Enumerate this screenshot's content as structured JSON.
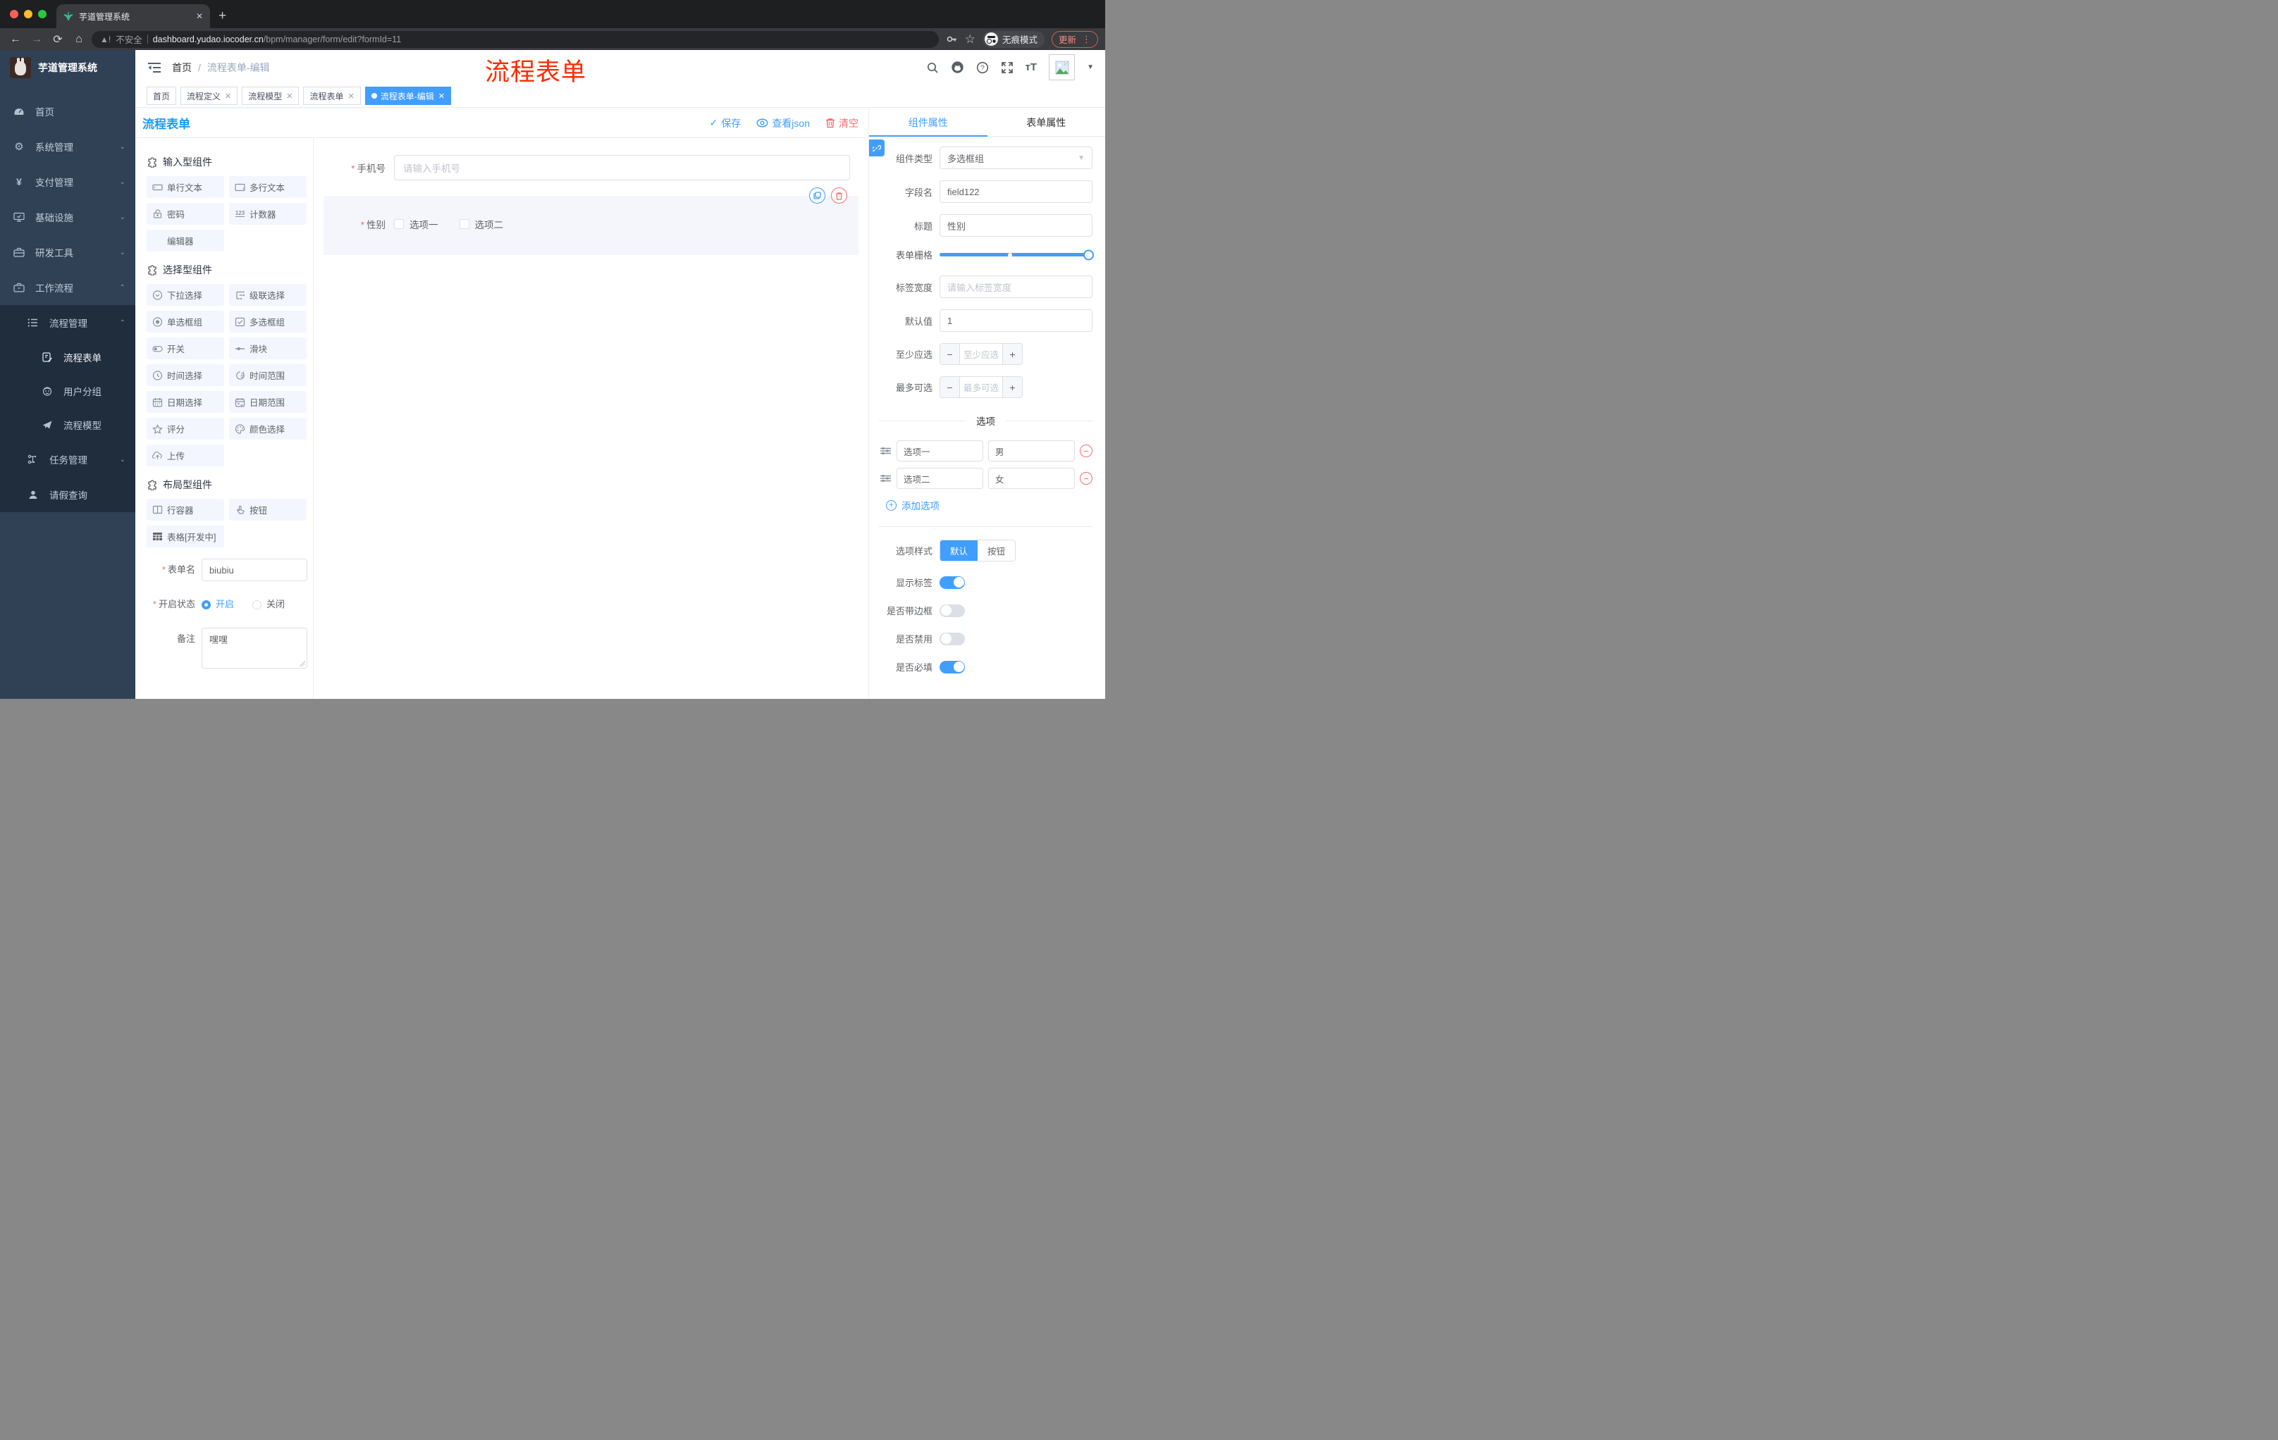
{
  "chrome": {
    "tab_title": "芋道管理系统",
    "url": {
      "security": "不安全",
      "domain": "dashboard.yudao.iocoder.cn",
      "path": "/bpm/manager/form/edit?formId=11"
    },
    "incognito_label": "无痕模式",
    "update_label": "更新",
    "nav_icons": [
      "back",
      "forward",
      "reload",
      "home"
    ],
    "right_icons": [
      "key",
      "bookmark-star"
    ]
  },
  "sidebar": {
    "brand": "芋道管理系统",
    "items": [
      {
        "label": "首页",
        "icon": "dashboard"
      },
      {
        "label": "系统管理",
        "icon": "gear",
        "chevron": "down"
      },
      {
        "label": "支付管理",
        "icon": "yen",
        "chevron": "down"
      },
      {
        "label": "基础设施",
        "icon": "monitor",
        "chevron": "down"
      },
      {
        "label": "研发工具",
        "icon": "toolbox",
        "chevron": "down"
      },
      {
        "label": "工作流程",
        "icon": "briefcase",
        "chevron": "up"
      }
    ],
    "submenu": [
      {
        "label": "流程管理",
        "icon": "flow-list",
        "chevron": "up",
        "level": 1
      },
      {
        "label": "流程表单",
        "icon": "form-doc",
        "level": 2,
        "active": true
      },
      {
        "label": "用户分组",
        "icon": "robot",
        "level": 2
      },
      {
        "label": "流程模型",
        "icon": "paper-plane",
        "level": 2
      },
      {
        "label": "任务管理",
        "icon": "task-tree",
        "chevron": "down",
        "level": 1
      },
      {
        "label": "请假查询",
        "icon": "person",
        "level": 1
      }
    ]
  },
  "topbar": {
    "breadcrumb": [
      "首页",
      "流程表单-编辑"
    ],
    "icons": [
      "search",
      "github",
      "question",
      "fullscreen",
      "font-size"
    ]
  },
  "tags": [
    {
      "label": "首页"
    },
    {
      "label": "流程定义",
      "closable": true
    },
    {
      "label": "流程模型",
      "closable": true
    },
    {
      "label": "流程表单",
      "closable": true
    },
    {
      "label": "流程表单-编辑",
      "closable": true,
      "active": true
    }
  ],
  "annotation": {
    "text": "流程表单"
  },
  "designer": {
    "title": "流程表单",
    "save_label": "保存",
    "view_json_label": "查看json",
    "clear_label": "清空"
  },
  "palette": {
    "sections": [
      {
        "title": "输入型组件",
        "icon": "puzzle",
        "items": [
          {
            "label": "单行文本",
            "icon": "text-input"
          },
          {
            "label": "多行文本",
            "icon": "textarea"
          },
          {
            "label": "密码",
            "icon": "lock"
          },
          {
            "label": "计数器",
            "icon": "counter"
          },
          {
            "label": "编辑器",
            "icon": "none"
          }
        ]
      },
      {
        "title": "选择型组件",
        "icon": "puzzle",
        "items": [
          {
            "label": "下拉选择",
            "icon": "select"
          },
          {
            "label": "级联选择",
            "icon": "cascader"
          },
          {
            "label": "单选框组",
            "icon": "radio"
          },
          {
            "label": "多选框组",
            "icon": "checkbox"
          },
          {
            "label": "开关",
            "icon": "switch"
          },
          {
            "label": "滑块",
            "icon": "slider"
          },
          {
            "label": "时间选择",
            "icon": "time"
          },
          {
            "label": "时间范围",
            "icon": "time-range"
          },
          {
            "label": "日期选择",
            "icon": "date"
          },
          {
            "label": "日期范围",
            "icon": "date-range"
          },
          {
            "label": "评分",
            "icon": "star"
          },
          {
            "label": "颜色选择",
            "icon": "color"
          },
          {
            "label": "上传",
            "icon": "upload"
          }
        ]
      },
      {
        "title": "布局型组件",
        "icon": "puzzle",
        "items": [
          {
            "label": "行容器",
            "icon": "row"
          },
          {
            "label": "按钮",
            "icon": "button"
          },
          {
            "label": "表格[开发中]",
            "icon": "table"
          }
        ]
      }
    ],
    "form": {
      "name_label": "表单名",
      "name_value": "biubiu",
      "status_label": "开启状态",
      "status_options": [
        "开启",
        "关闭"
      ],
      "status_selected": 0,
      "remark_label": "备注",
      "remark_value": "嘿嘿"
    }
  },
  "canvas": {
    "phone_label": "手机号",
    "phone_placeholder": "请输入手机号",
    "gender_label": "性别",
    "gender_options": [
      "选项一",
      "选项二"
    ]
  },
  "panel": {
    "tabs": [
      "组件属性",
      "表单属性"
    ],
    "component_type_label": "组件类型",
    "component_type_value": "多选框组",
    "field_name_label": "字段名",
    "field_name_value": "field122",
    "title_label": "标题",
    "title_value": "性别",
    "grid_label": "表单栅格",
    "label_width_label": "标签宽度",
    "label_width_placeholder": "请输入标签宽度",
    "default_label": "默认值",
    "default_value": "1",
    "min_label": "至少应选",
    "min_placeholder": "至少应选",
    "max_label": "最多可选",
    "max_placeholder": "最多可选",
    "options_divider": "选项",
    "options": [
      {
        "label": "选项一",
        "value": "男"
      },
      {
        "label": "选项二",
        "value": "女"
      }
    ],
    "add_option_label": "添加选项",
    "style_label": "选项样式",
    "style_options": [
      "默认",
      "按钮"
    ],
    "style_selected": 0,
    "toggles": [
      {
        "label": "显示标签",
        "on": true
      },
      {
        "label": "是否带边框",
        "on": false
      },
      {
        "label": "是否禁用",
        "on": false
      },
      {
        "label": "是否必填",
        "on": true
      }
    ]
  },
  "colors": {
    "accent": "#409eff",
    "danger": "#f56c6c",
    "annotation_red": "#ff2b00",
    "sidebar_bg": "#304156",
    "submenu_bg": "#1f2d3d"
  }
}
